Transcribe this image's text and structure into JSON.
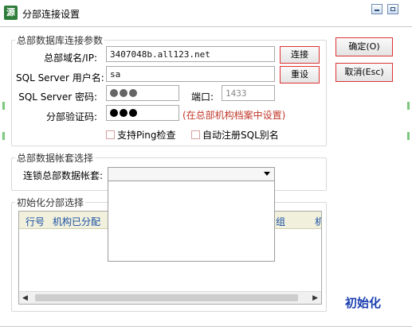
{
  "window": {
    "title": "分部连接设置",
    "icon_glyph": "源"
  },
  "connection": {
    "legend": "总部数据库连接参数",
    "domain_label": "总部域名/IP:",
    "domain_value": "3407048b.all123.net",
    "sql_user_label": "SQL Server 用户名:",
    "sql_user_value": "sa",
    "sql_password_label": "SQL Server 密码:",
    "port_label": "端口:",
    "port_value": "1433",
    "branch_code_label": "分部验证码:",
    "branch_code_hint": "(在总部机构档案中设置)",
    "connect_button": "连接",
    "reset_button": "重设",
    "ping_check_label": "支持Ping检查",
    "auto_register_label": "自动注册SQL别名"
  },
  "actions": {
    "ok_button": "确定(O)",
    "cancel_button": "取消(Esc)"
  },
  "account_set": {
    "legend": "总部数据帐套选择",
    "label": "连锁总部数据帐套:",
    "selected_value": ""
  },
  "init": {
    "legend": "初始化分部选择",
    "columns": [
      "行号",
      "机构已分配",
      "组",
      "机"
    ],
    "init_button": "初始化"
  },
  "colors": {
    "accent_red": "#c0392b",
    "header_blue": "#1a4fa3",
    "init_blue": "#1c3fb0"
  }
}
